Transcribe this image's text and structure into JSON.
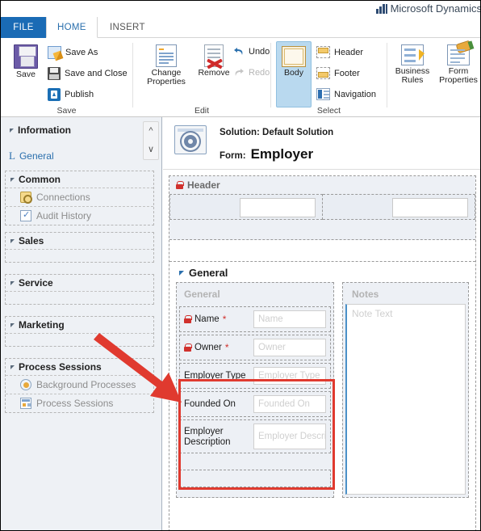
{
  "brand": {
    "name": "Microsoft Dynamics",
    "logo_icon": "dynamics-logo-icon"
  },
  "tabs": [
    {
      "id": "file",
      "label": "FILE",
      "active": false
    },
    {
      "id": "home",
      "label": "HOME",
      "active": true
    },
    {
      "id": "insert",
      "label": "INSERT",
      "active": false
    }
  ],
  "ribbon": {
    "groups": [
      {
        "id": "save",
        "label": "Save",
        "big_button": {
          "label": "Save",
          "icon": "floppy-disk-icon"
        },
        "items": [
          {
            "label": "Save As",
            "icon": "save-as-icon"
          },
          {
            "label": "Save and Close",
            "icon": "save-and-close-icon"
          },
          {
            "label": "Publish",
            "icon": "publish-icon"
          }
        ]
      },
      {
        "id": "edit",
        "label": "Edit",
        "big_buttons": [
          {
            "label": "Change Properties",
            "icon": "change-properties-icon"
          },
          {
            "label": "Remove",
            "icon": "remove-icon"
          }
        ],
        "items": [
          {
            "label": "Undo",
            "icon": "undo-arrow-icon",
            "disabled": false
          },
          {
            "label": "Redo",
            "icon": "redo-arrow-icon",
            "disabled": true
          }
        ]
      },
      {
        "id": "select",
        "label": "Select",
        "big_button": {
          "label": "Body",
          "icon": "body-icon",
          "selected": true
        },
        "items": [
          {
            "label": "Header",
            "icon": "header-icon"
          },
          {
            "label": "Footer",
            "icon": "footer-icon"
          },
          {
            "label": "Navigation",
            "icon": "navigation-icon"
          }
        ]
      },
      {
        "id": "tools",
        "label": "",
        "big_buttons": [
          {
            "label": "Business Rules",
            "icon": "business-rules-icon"
          },
          {
            "label": "Form Properties",
            "icon": "form-properties-icon"
          }
        ]
      }
    ]
  },
  "leftnav": {
    "scroll_up_icon": "chevron-up-icon",
    "scroll_down_icon": "chevron-down-icon",
    "information": {
      "label": "Information",
      "sub_label": "General",
      "sub_glyph": "L"
    },
    "sections": [
      {
        "label": "Common",
        "items": [
          {
            "label": "Connections",
            "icon": "connections-icon"
          },
          {
            "label": "Audit History",
            "icon": "audit-history-icon"
          }
        ]
      },
      {
        "label": "Sales",
        "items": []
      },
      {
        "label": "Service",
        "items": []
      },
      {
        "label": "Marketing",
        "items": []
      },
      {
        "label": "Process Sessions",
        "items": [
          {
            "label": "Background Processes",
            "icon": "background-processes-icon"
          },
          {
            "label": "Process Sessions",
            "icon": "process-sessions-icon"
          }
        ]
      }
    ]
  },
  "canvas": {
    "form_icon": "form-designer-icon",
    "solution_line": "Solution: Default Solution",
    "form_prefix": "Form:",
    "form_name": "Employer",
    "header_section": {
      "label": "Header",
      "lock_icon": "lock-icon"
    },
    "general_section": {
      "label": "General",
      "collapse_icon": "triangle-collapse-icon",
      "left_column": {
        "title": "General",
        "fields": [
          {
            "label": "Name",
            "placeholder": "Name",
            "required": true,
            "locked": true,
            "tall": false
          },
          {
            "label": "Owner",
            "placeholder": "Owner",
            "required": true,
            "locked": true,
            "tall": false
          },
          {
            "label": "Employer Type",
            "placeholder": "Employer Type",
            "required": false,
            "locked": false,
            "tall": false
          },
          {
            "label": "Founded On",
            "placeholder": "Founded On",
            "required": false,
            "locked": false,
            "tall": false
          },
          {
            "label": "Employer Description",
            "placeholder": "Employer Descri",
            "required": false,
            "locked": false,
            "tall": true
          }
        ]
      },
      "right_column": {
        "title": "Notes",
        "note_placeholder": "Note Text"
      }
    }
  },
  "annotations": {
    "highlight_box_color": "#e03a2f",
    "arrow_color": "#e03a2f"
  }
}
